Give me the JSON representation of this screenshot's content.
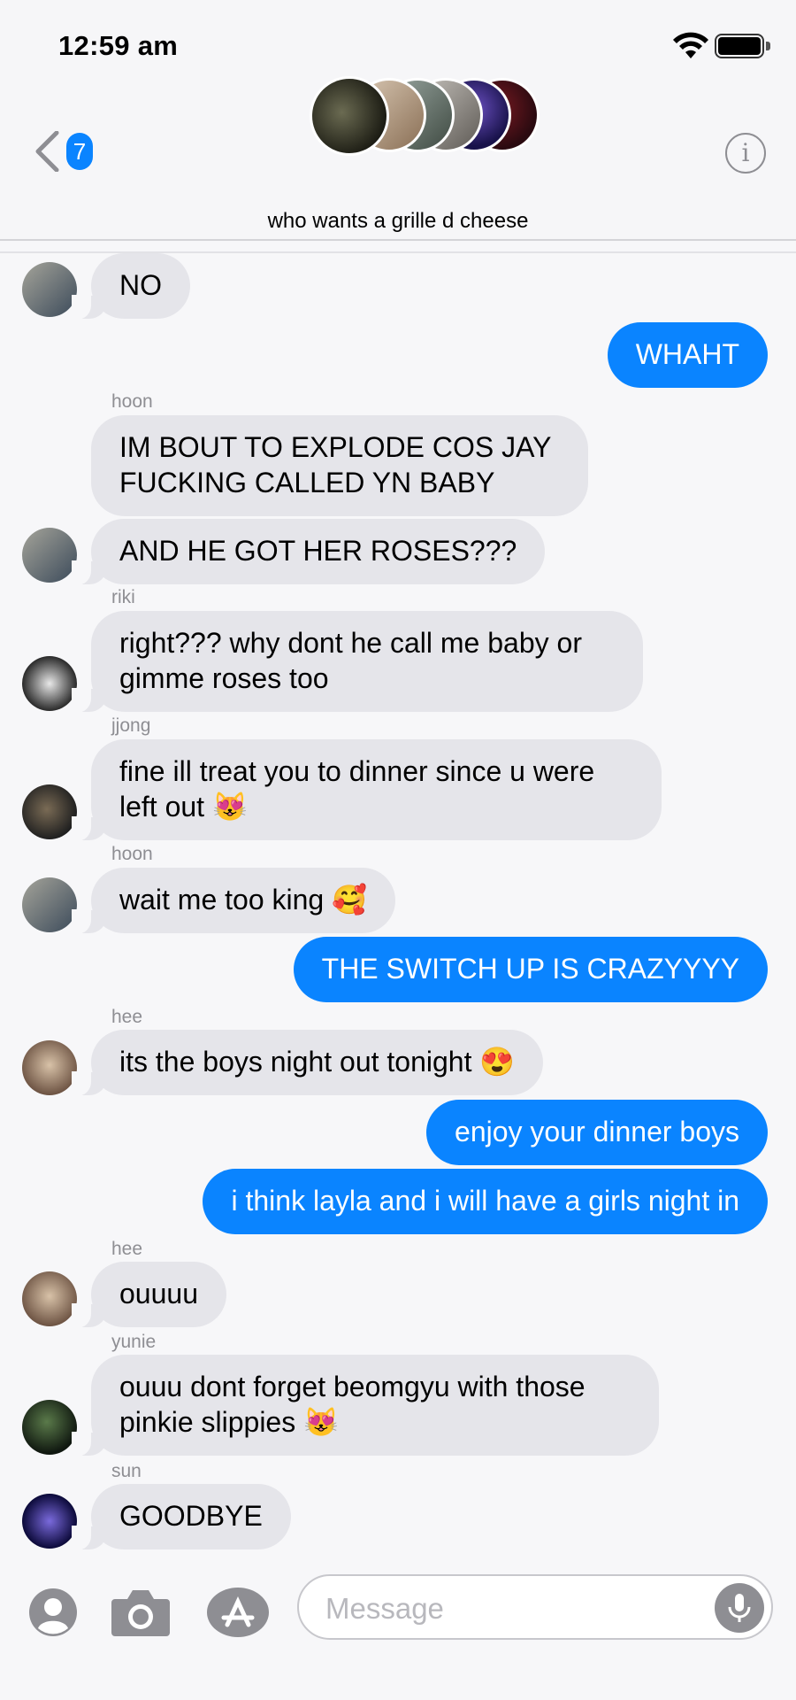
{
  "status_bar": {
    "time": "12:59 am"
  },
  "header": {
    "back_badge_count": "7",
    "chat_title": "who wants a grille d cheese",
    "info_label": "i"
  },
  "messages": [
    {
      "sender": "",
      "text": "NO"
    },
    {
      "sender": "",
      "text": "WHAHT"
    },
    {
      "sender": "hoon",
      "text": "IM BOUT TO EXPLODE COS JAY FUCKING CALLED YN BABY"
    },
    {
      "sender": "",
      "text": "AND HE GOT HER ROSES???"
    },
    {
      "sender": "riki",
      "text": "right??? why dont he call me baby or gimme roses too"
    },
    {
      "sender": "jjong",
      "text": "fine ill treat you to dinner since u were left out 😻"
    },
    {
      "sender": "hoon",
      "text": "wait me too king 🥰"
    },
    {
      "sender": "",
      "text": "THE SWITCH UP IS CRAZYYYY"
    },
    {
      "sender": "hee",
      "text": "its the boys night out tonight 😍"
    },
    {
      "sender": "",
      "text": "enjoy your dinner boys"
    },
    {
      "sender": "",
      "text": "i think layla and i will have a girls night in"
    },
    {
      "sender": "hee",
      "text": "ouuuu"
    },
    {
      "sender": "yunie",
      "text": "ouuu dont forget beomgyu with those pinkie slippies 😻"
    },
    {
      "sender": "sun",
      "text": "GOODBYE"
    }
  ],
  "input": {
    "placeholder": "Message"
  },
  "colors": {
    "outgoing": "#0a84ff",
    "incoming": "#e5e5ea",
    "accent": "#0a84ff"
  },
  "icons": [
    "wifi-icon",
    "battery-icon",
    "back-chevron-icon",
    "info-icon",
    "contact-icon",
    "camera-icon",
    "app-store-icon",
    "microphone-icon"
  ]
}
